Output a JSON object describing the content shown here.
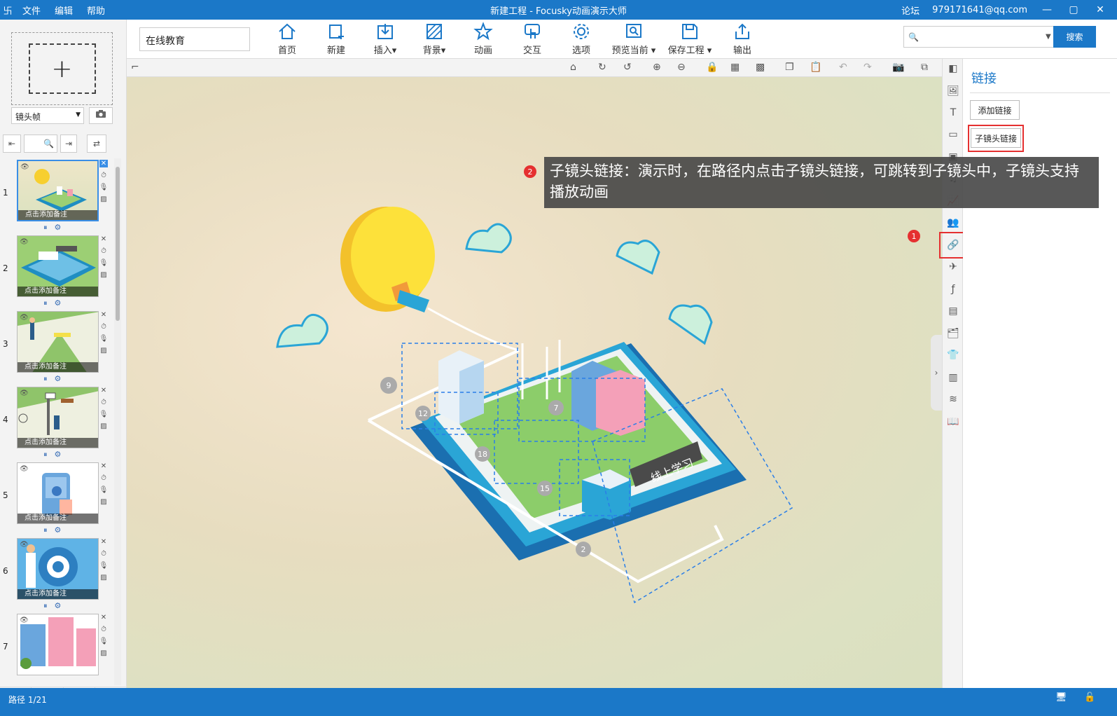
{
  "app": {
    "logo_glyph": "卐",
    "menu": [
      "文件",
      "编辑",
      "帮助"
    ],
    "window_title": "新建工程 - Focusky动画演示大师",
    "forum": "论坛",
    "account": "979171641@qq.com",
    "window_buttons": [
      "—",
      "▢",
      "✕"
    ]
  },
  "toolbar": {
    "project_name": "在线教育",
    "buttons": [
      {
        "label": "首页",
        "icon": "home-icon"
      },
      {
        "label": "新建",
        "icon": "new-frame-icon"
      },
      {
        "label": "插入",
        "icon": "insert-icon",
        "dropdown": true
      },
      {
        "label": "背景",
        "icon": "background-icon",
        "dropdown": true
      },
      {
        "label": "动画",
        "icon": "animation-icon"
      },
      {
        "label": "交互",
        "icon": "interaction-icon"
      },
      {
        "label": "选项",
        "icon": "options-icon"
      },
      {
        "label": "预览当前",
        "icon": "preview-icon",
        "dropdown": true
      },
      {
        "label": "保存工程",
        "icon": "save-icon",
        "dropdown": true
      },
      {
        "label": "输出",
        "icon": "export-icon"
      }
    ],
    "search_placeholder": "",
    "search_button": "搜索"
  },
  "left": {
    "add_glyph": "+",
    "frame_type": "镜头帧",
    "slides": [
      {
        "num": "1",
        "note": "点击添加备注",
        "selected": true
      },
      {
        "num": "2",
        "note": "点击添加备注"
      },
      {
        "num": "3",
        "note": "点击添加备注"
      },
      {
        "num": "4",
        "note": "点击添加备注"
      },
      {
        "num": "5",
        "note": "点击添加备注"
      },
      {
        "num": "6",
        "note": "点击添加备注"
      },
      {
        "num": "7",
        "note": ""
      }
    ]
  },
  "right": {
    "panel_title": "链接",
    "add_link": "添加链接",
    "sub_camera_link": "子镜头链接"
  },
  "tooltip": {
    "badge": "2",
    "text": "子镜头链接：演示时，在路径内点击子镜头链接，可跳转到子镜头中，子镜头支持播放动画"
  },
  "callout_badge": "1",
  "canvas": {
    "sign_text": "线上学习",
    "path_numbers": [
      "9",
      "12",
      "7",
      "18",
      "15",
      "2"
    ]
  },
  "status": {
    "path": "路径 1/21"
  },
  "colors": {
    "brand_blue": "#1b78c8",
    "highlight_red": "#e53030"
  }
}
